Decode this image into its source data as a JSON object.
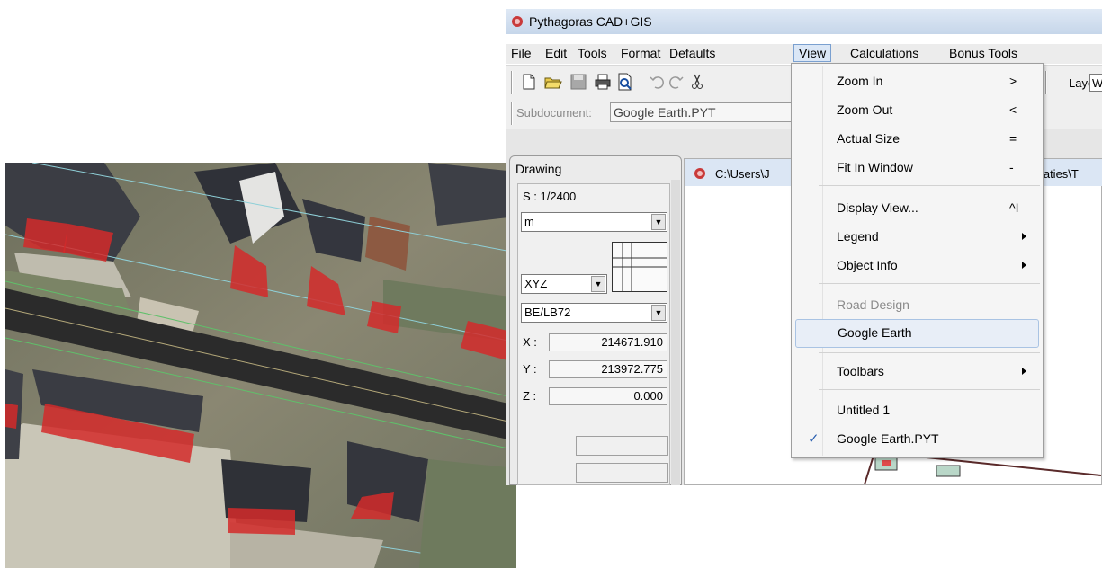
{
  "app": {
    "title": "Pythagoras CAD+GIS",
    "menu": [
      "File",
      "Edit",
      "Tools",
      "Format",
      "Defaults",
      "View",
      "Calculations",
      "Bonus Tools"
    ],
    "open_menu": "View"
  },
  "toolbar": {
    "layer_label": "Layer:",
    "layer_value": "W"
  },
  "subdocument": {
    "label": "Subdocument:",
    "value": "Google Earth.PYT"
  },
  "drawing_panel": {
    "title": "Drawing",
    "scale": "S : 1/2400",
    "unit": "m",
    "coord_mode": "XYZ",
    "projection": "BE/LB72",
    "x_label": "X :",
    "x_value": "214671.910",
    "y_label": "Y :",
    "y_value": "213972.775",
    "z_label": "Z :",
    "z_value": "0.000"
  },
  "document": {
    "path_left": "C:\\Users\\J",
    "path_right": "ntaties\\T"
  },
  "view_menu": {
    "items": [
      {
        "label": "Zoom In",
        "shortcut": ">"
      },
      {
        "label": "Zoom Out",
        "shortcut": "<"
      },
      {
        "label": "Actual Size",
        "shortcut": "="
      },
      {
        "label": "Fit In Window",
        "shortcut": "-"
      },
      {
        "label": "Display View...",
        "shortcut": "^I"
      },
      {
        "label": "Legend",
        "submenu": true
      },
      {
        "label": "Object Info",
        "submenu": true
      },
      {
        "label": "Road Design",
        "disabled": true
      },
      {
        "label": "Google Earth",
        "highlighted": true
      },
      {
        "label": "Toolbars",
        "submenu": true
      },
      {
        "label": "Untitled 1"
      },
      {
        "label": "Google Earth.PYT",
        "checked": true
      }
    ]
  },
  "colors": {
    "building_overlay": "#d42a2a",
    "road": "#2b2b2b",
    "menu_highlight": "#e8eef7",
    "check": "#2a5fb0"
  }
}
